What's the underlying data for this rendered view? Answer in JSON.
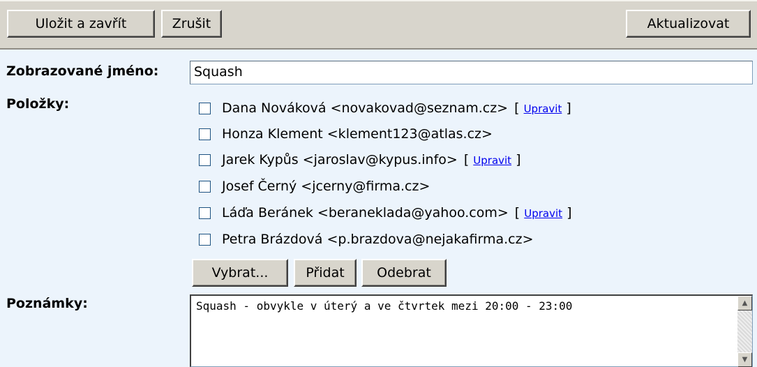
{
  "toolbar": {
    "save_close_label": "Uložit a zavřít",
    "cancel_label": "Zrušit",
    "update_label": "Aktualizovat"
  },
  "form": {
    "display_name_label": "Zobrazované jméno:",
    "display_name_value": "Squash",
    "items_label": "Položky:",
    "notes_label": "Poznámky:",
    "notes_value": "Squash - obvykle v úterý a ve čtvrtek mezi 20:00 - 23:00"
  },
  "members": [
    {
      "text": "Dana Nováková <novakovad@seznam.cz>",
      "checked": false,
      "edit": "Upravit"
    },
    {
      "text": "Honza Klement <klement123@atlas.cz>",
      "checked": false,
      "edit": ""
    },
    {
      "text": "Jarek Kypůs <jaroslav@kypus.info>",
      "checked": false,
      "edit": "Upravit"
    },
    {
      "text": "Josef Černý <jcerny@firma.cz>",
      "checked": false,
      "edit": ""
    },
    {
      "text": "Láďa Beránek <beraneklada@yahoo.com>",
      "checked": false,
      "edit": "Upravit"
    },
    {
      "text": "Petra Brázdová <p.brazdova@nejakafirma.cz>",
      "checked": false,
      "edit": ""
    }
  ],
  "member_actions": {
    "select_label": "Vybrat...",
    "add_label": "Přidat",
    "remove_label": "Odebrat"
  },
  "icons": {
    "scroll_up": "▲",
    "scroll_down": "▼"
  }
}
